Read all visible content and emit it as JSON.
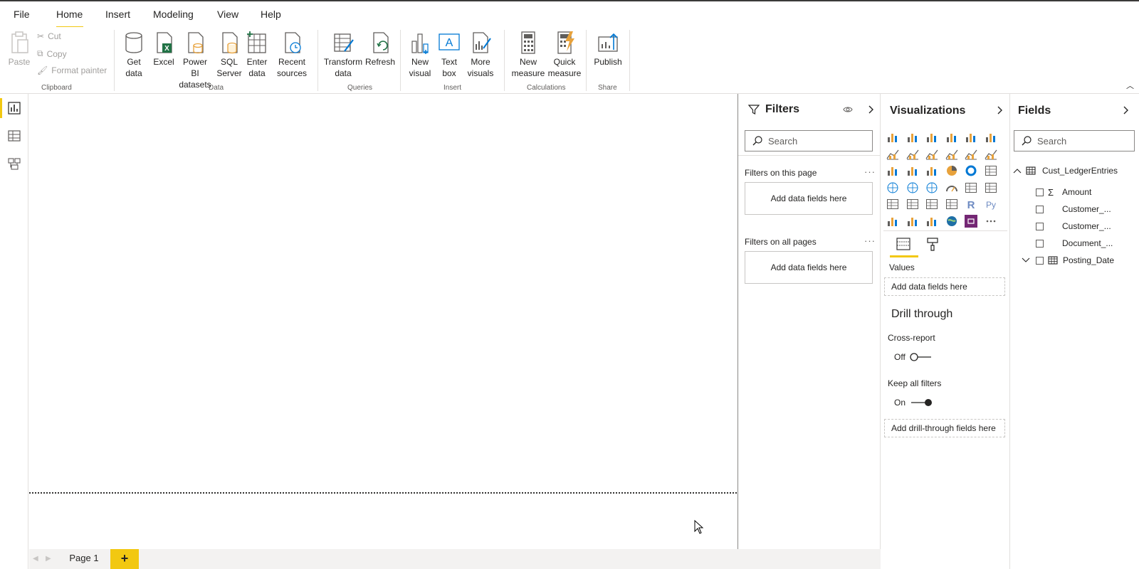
{
  "menu": {
    "tabs": [
      {
        "label": "File"
      },
      {
        "label": "Home"
      },
      {
        "label": "Insert"
      },
      {
        "label": "Modeling"
      },
      {
        "label": "View"
      },
      {
        "label": "Help"
      }
    ],
    "active_tab": "Home"
  },
  "ribbon": {
    "clipboard": {
      "paste": "Paste",
      "cut": "Cut",
      "copy": "Copy",
      "format_painter": "Format painter",
      "group": "Clipboard"
    },
    "data": {
      "get_data": "Get\ndata",
      "excel": "Excel",
      "power_bi": "Power BI\ndatasets",
      "sql": "SQL\nServer",
      "enter_data": "Enter\ndata",
      "recent": "Recent\nsources",
      "group": "Data"
    },
    "queries": {
      "transform": "Transform\ndata",
      "refresh": "Refresh",
      "group": "Queries"
    },
    "insert": {
      "new_visual": "New\nvisual",
      "text_box": "Text\nbox",
      "more_visuals": "More\nvisuals",
      "group": "Insert"
    },
    "calculations": {
      "new_measure": "New\nmeasure",
      "quick_measure": "Quick\nmeasure",
      "group": "Calculations"
    },
    "share": {
      "publish": "Publish",
      "group": "Share"
    }
  },
  "pages": {
    "tabs": [
      {
        "label": "Page 1"
      }
    ],
    "add_label": "+"
  },
  "filters": {
    "title": "Filters",
    "search_placeholder": "Search",
    "on_this_page": "Filters on this page",
    "on_all_pages": "Filters on all pages",
    "add_fields": "Add data fields here",
    "more": "···"
  },
  "visualizations": {
    "title": "Visualizations",
    "values_label": "Values",
    "values_well": "Add data fields here",
    "drill_through": "Drill through",
    "cross_report": "Cross-report",
    "cross_report_state": "Off",
    "keep_all_filters": "Keep all filters",
    "keep_all_filters_state": "On",
    "drill_well": "Add drill-through fields here",
    "more": "···"
  },
  "fields": {
    "title": "Fields",
    "search_placeholder": "Search",
    "table_name": "Cust_LedgerEntries",
    "items": [
      {
        "label": "Amount",
        "icon": "sigma-icon"
      },
      {
        "label": "Customer_...",
        "icon": ""
      },
      {
        "label": "Customer_...",
        "icon": ""
      },
      {
        "label": "Document_...",
        "icon": ""
      },
      {
        "label": "Posting_Date",
        "icon": "calendar-table-icon"
      }
    ]
  },
  "colors": {
    "accent": "#f2c811",
    "text": "#252423",
    "excel_green": "#217346",
    "blue": "#0078d4",
    "orange": "#e8a23b"
  }
}
